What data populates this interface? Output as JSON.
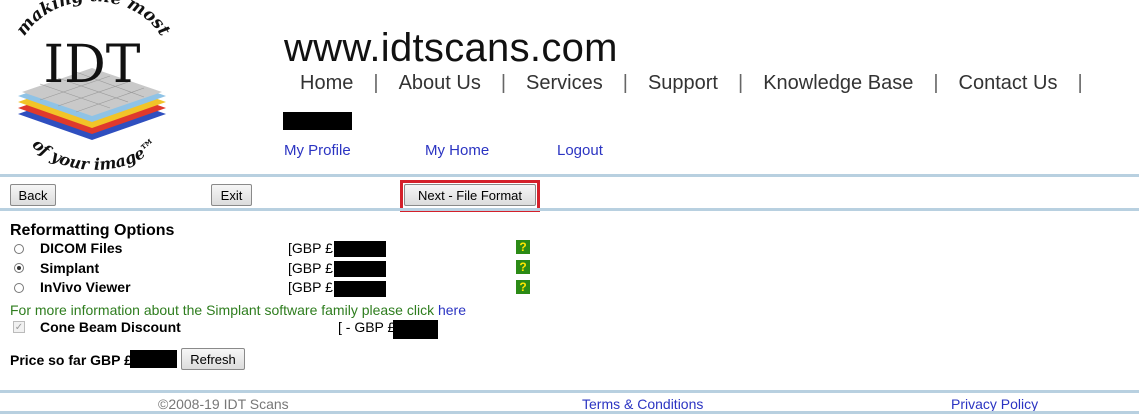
{
  "logo": {
    "top_arc_text": "making the most",
    "letters": "IDT",
    "bottom_arc_text": "of your image™"
  },
  "header": {
    "site_url": "www.idtscans.com",
    "nav": [
      "Home",
      "About Us",
      "Services",
      "Support",
      "Knowledge Base",
      "Contact Us"
    ],
    "separator": "|",
    "sub_links": {
      "profile": "My Profile",
      "home": "My Home",
      "logout": "Logout"
    }
  },
  "toolbar": {
    "back": "Back",
    "exit": "Exit",
    "next": "Next - File Format"
  },
  "options": {
    "title": "Reformatting Options",
    "items": [
      {
        "label": "DICOM Files",
        "price_prefix": "[GBP £",
        "selected": false
      },
      {
        "label": "Simplant",
        "price_prefix": "[GBP £",
        "selected": true
      },
      {
        "label": "InVivo Viewer",
        "price_prefix": "[GBP £",
        "selected": false
      }
    ],
    "help_glyph": "?",
    "info_text": "For more information about the Simplant software family please click ",
    "info_link": "here",
    "discount_label": "Cone Beam Discount",
    "discount_prefix": "[ - GBP £",
    "discount_checked": true
  },
  "price": {
    "label": "Price so far GBP £",
    "refresh": "Refresh"
  },
  "footer": {
    "copyright": "©2008-19 IDT Scans",
    "terms": "Terms & Conditions",
    "privacy": "Privacy Policy"
  },
  "colors": {
    "link": "#2b34c2",
    "rule": "#b8d0e0",
    "highlight": "#d4202a",
    "help_bg": "#2b8a16",
    "info_text": "#2e7d1e"
  }
}
